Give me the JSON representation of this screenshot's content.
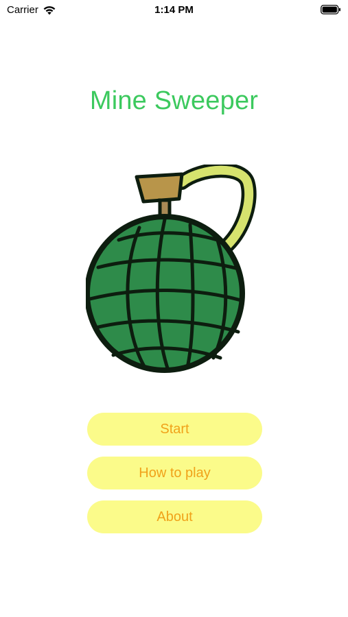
{
  "status_bar": {
    "carrier": "Carrier",
    "time": "1:14 PM",
    "wifi_icon": "wifi-icon",
    "battery_icon": "battery-icon"
  },
  "title": "Mine Sweeper",
  "illustration": {
    "icon": "bomb-icon",
    "colors": {
      "body": "#2e8b4a",
      "outline": "#0d1d0f",
      "cap": "#b8954a",
      "handle": "#d6e36e"
    }
  },
  "menu": {
    "start_label": "Start",
    "how_to_play_label": "How to play",
    "about_label": "About"
  },
  "colors": {
    "title": "#3cc95e",
    "button_bg": "#fbfb8a",
    "button_text": "#f0a21a",
    "background": "#ffffff"
  }
}
